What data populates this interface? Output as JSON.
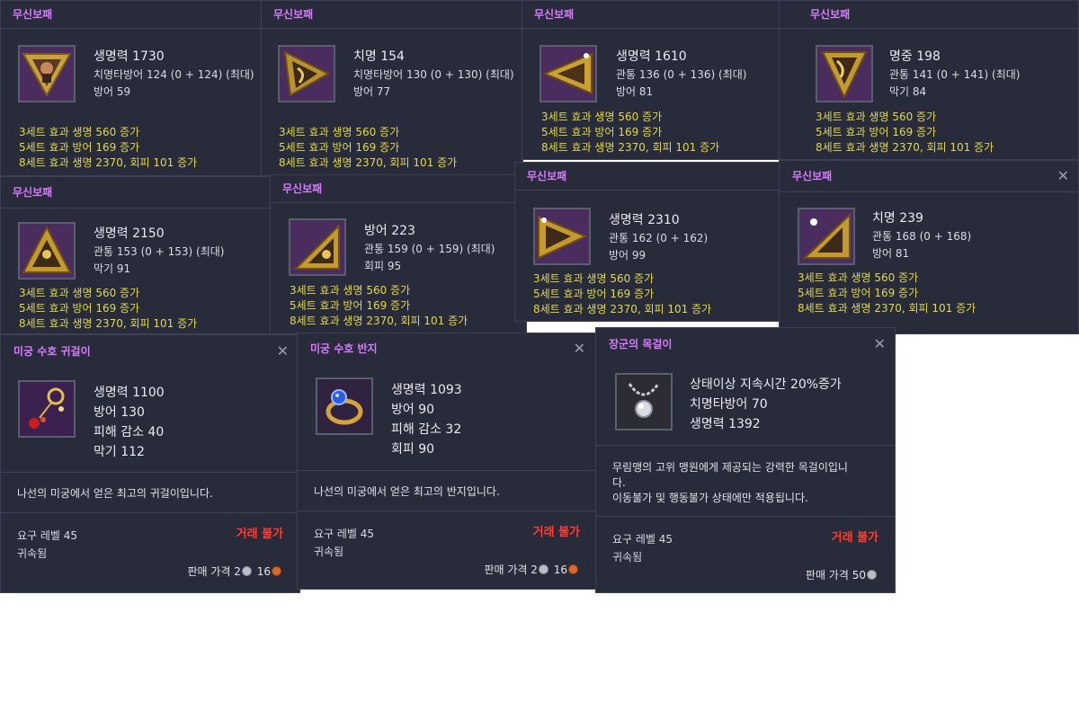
{
  "set_name": "무신보패",
  "set_effects": [
    "3세트 효과 생명 560 증가",
    "5세트 효과 방어 169 증가",
    "8세트 효과 생명 2370, 회피 101 증가"
  ],
  "close_symbol": "✕",
  "boxing_panels": [
    {
      "title": "무신보패",
      "icon": "triangle-face-icon",
      "lines": [
        "생명력 1730",
        "치명타방어 124 (0 + 124) (최대)",
        "방어 59"
      ]
    },
    {
      "title": "무신보패",
      "icon": "triangle-gold-icon",
      "lines": [
        "치명 154",
        "치명타방어 130 (0 + 130) (최대)",
        "방어 77"
      ]
    },
    {
      "title": "무신보패",
      "icon": "triangle-gold-icon",
      "lines": [
        "생명력 1610",
        "관통 136 (0 + 136) (최대)",
        "방어 81"
      ]
    },
    {
      "title": "무신보패",
      "icon": "triangle-gold-icon",
      "lines": [
        "명중 198",
        "관통 141 (0 + 141) (최대)",
        "막기 84"
      ]
    },
    {
      "title": "무신보패",
      "icon": "triangle-gold-icon",
      "lines": [
        "생명력 2150",
        "관통 153 (0 + 153) (최대)",
        "막기 91"
      ]
    },
    {
      "title": "무신보패",
      "icon": "triangle-gold-icon",
      "lines": [
        "방어 223",
        "관통 159 (0 + 159) (최대)",
        "회피 95"
      ]
    },
    {
      "title": "무신보패",
      "icon": "triangle-gold-icon",
      "lines": [
        "생명력 2310",
        "관통 162 (0 + 162)",
        "방어 99"
      ]
    },
    {
      "title": "무신보패",
      "icon": "triangle-gold-icon",
      "lines": [
        "치명 239",
        "관통 168 (0 + 168)",
        "방어 81"
      ]
    }
  ],
  "accessories": [
    {
      "title": "미궁 수호 귀걸이",
      "icon": "earring-icon",
      "stats": [
        "생명력 1100",
        "방어 130",
        "피해 감소 40",
        "막기 112"
      ],
      "description": [
        "나선의 미궁에서 얻은 최고의 귀걸이입니다."
      ],
      "required_level": "요구 레벨 45",
      "bound": "귀속됨",
      "trade": "거래 불가",
      "price_label": "판매 가격",
      "price_silver": "2",
      "price_copper": "16"
    },
    {
      "title": "미궁 수호 반지",
      "icon": "ring-icon",
      "stats": [
        "생명력 1093",
        "방어 90",
        "피해 감소 32",
        "회피 90"
      ],
      "description": [
        "나선의 미궁에서 얻은 최고의 반지입니다."
      ],
      "required_level": "요구 레벨 45",
      "bound": "귀속됨",
      "trade": "거래 불가",
      "price_label": "판매 가격",
      "price_silver": "2",
      "price_copper": "16"
    },
    {
      "title": "장군의 목걸이",
      "icon": "necklace-icon",
      "stats": [
        "상태이상 지속시간 20%증가",
        "치명타방어 70",
        "생명력 1392"
      ],
      "description": [
        "무림맹의 고위 맹원에게 제공되는 강력한 목걸이입니",
        "다.",
        "이동불가 및 행동불가 상태에만 적용됩니다."
      ],
      "required_level": "요구 레벨 45",
      "bound": "귀속됨",
      "trade": "거래 불가",
      "price_label": "판매 가격",
      "price_silver": "50"
    }
  ]
}
